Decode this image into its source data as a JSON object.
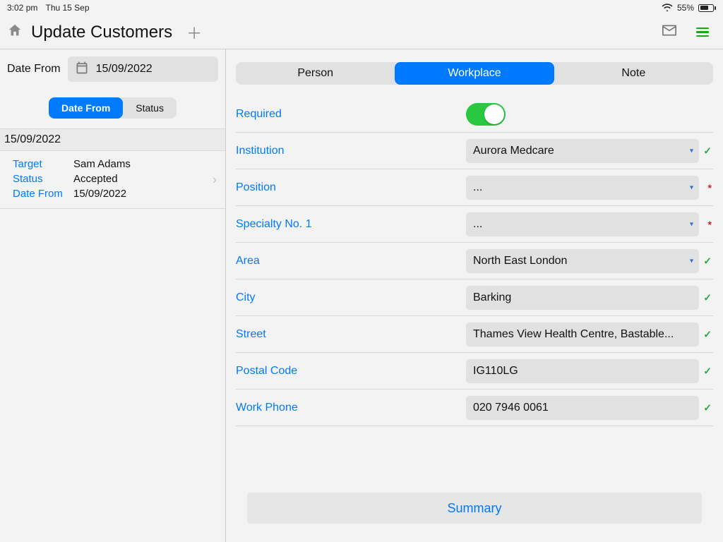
{
  "status_bar": {
    "time": "3:02 pm",
    "date": "Thu 15 Sep",
    "battery_pct": "55%"
  },
  "header": {
    "title": "Update Customers"
  },
  "left": {
    "date_from_label": "Date From",
    "date_from_value": "15/09/2022",
    "mini_tabs": {
      "date_from": "Date From",
      "status": "Status",
      "selected": "date_from"
    },
    "group_date": "15/09/2022",
    "item": {
      "target_label": "Target",
      "target_value": "Sam Adams",
      "status_label": "Status",
      "status_value": "Accepted",
      "date_label": "Date From",
      "date_value": "15/09/2022"
    }
  },
  "tabs": {
    "person": "Person",
    "workplace": "Workplace",
    "note": "Note",
    "selected": "workplace"
  },
  "form": {
    "required_label": "Required",
    "required_on": true,
    "institution_label": "Institution",
    "institution_value": "Aurora Medcare",
    "position_label": "Position",
    "position_value": "...",
    "specialty_label": "Specialty No. 1",
    "specialty_value": "...",
    "area_label": "Area",
    "area_value": "North East London",
    "city_label": "City",
    "city_value": "Barking",
    "street_label": "Street",
    "street_value": "Thames View Health Centre,  Bastable...",
    "postal_label": "Postal Code",
    "postal_value": "IG110LG",
    "phone_label": "Work Phone",
    "phone_value": "020 7946 0061"
  },
  "summary_label": "Summary"
}
